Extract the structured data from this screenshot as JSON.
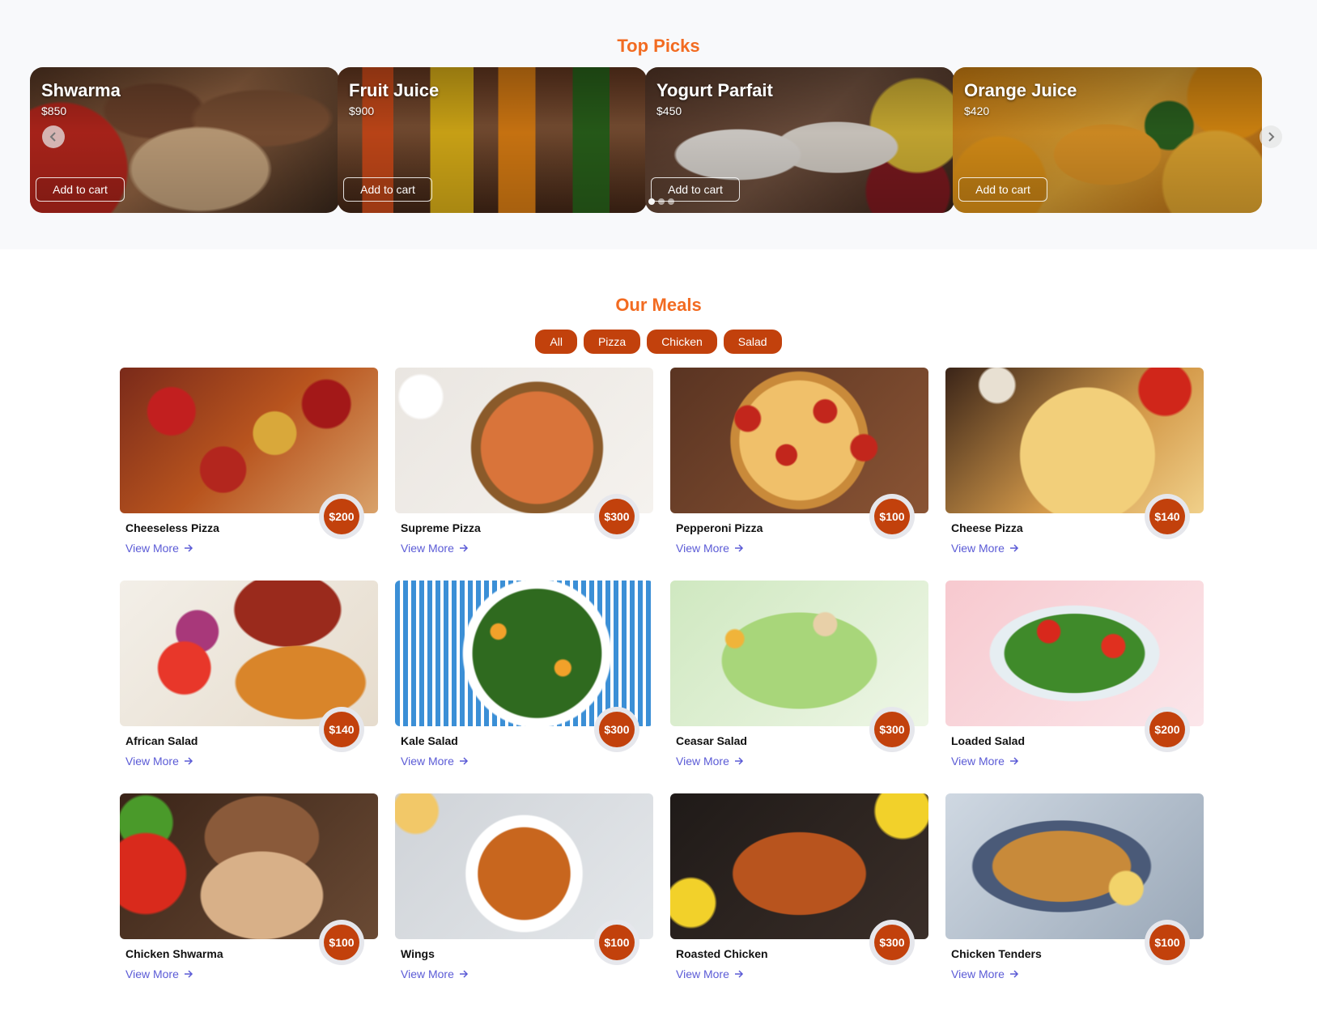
{
  "top_picks": {
    "title": "Top Picks",
    "items": [
      {
        "name": "Shwarma",
        "price": "$850",
        "button": "Add to cart"
      },
      {
        "name": "Fruit Juice",
        "price": "$900",
        "button": "Add to cart"
      },
      {
        "name": "Yogurt Parfait",
        "price": "$450",
        "button": "Add to cart"
      },
      {
        "name": "Orange Juice",
        "price": "$420",
        "button": "Add to cart"
      }
    ],
    "prev_icon": "chevron-left-icon",
    "next_icon": "chevron-right-icon"
  },
  "meals": {
    "title": "Our Meals",
    "filters": [
      "All",
      "Pizza",
      "Chicken",
      "Salad"
    ],
    "view_more": "View More",
    "items": [
      {
        "name": "Cheeseless Pizza",
        "price": "$200"
      },
      {
        "name": "Supreme Pizza",
        "price": "$300"
      },
      {
        "name": "Pepperoni Pizza",
        "price": "$100"
      },
      {
        "name": "Cheese Pizza",
        "price": "$140"
      },
      {
        "name": "African Salad",
        "price": "$140"
      },
      {
        "name": "Kale Salad",
        "price": "$300"
      },
      {
        "name": "Ceasar Salad",
        "price": "$300"
      },
      {
        "name": "Loaded Salad",
        "price": "$200"
      },
      {
        "name": "Chicken Shwarma",
        "price": "$100"
      },
      {
        "name": "Wings",
        "price": "$100"
      },
      {
        "name": "Roasted Chicken",
        "price": "$300"
      },
      {
        "name": "Chicken Tenders",
        "price": "$100"
      }
    ]
  },
  "colors": {
    "accent": "#f26b21",
    "badge": "#c2410c",
    "link": "#5b5bd6"
  }
}
